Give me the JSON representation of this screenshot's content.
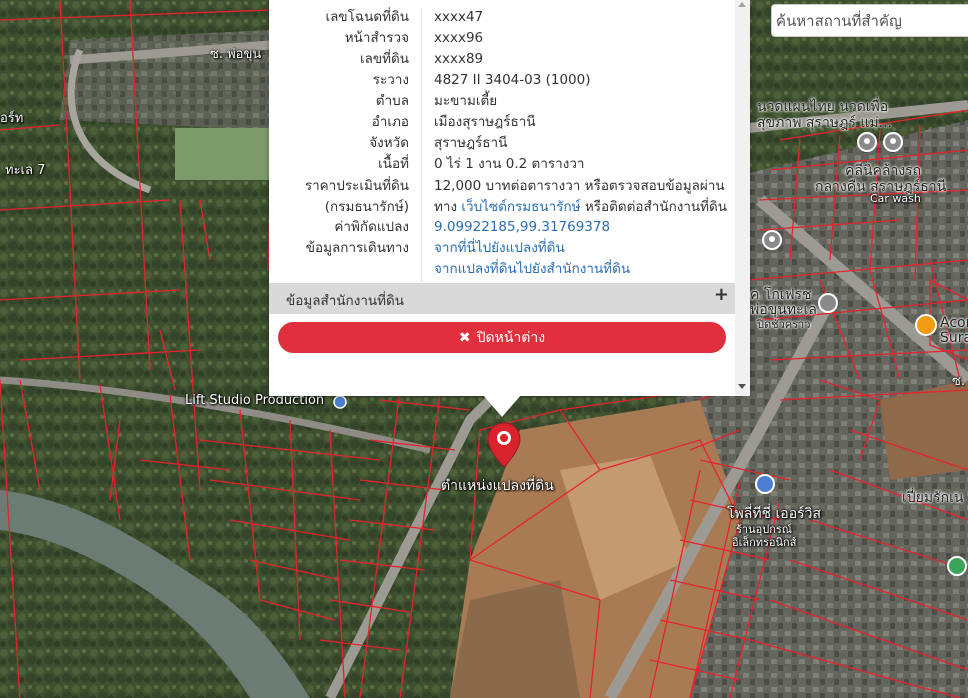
{
  "search": {
    "placeholder": "ค้นหาสถานที่สำคัญ"
  },
  "popup": {
    "rows": [
      {
        "key": "เลขโฉนดที่ดิน",
        "value": "xxxx47"
      },
      {
        "key": "หน้าสำรวจ",
        "value": "xxxx96"
      },
      {
        "key": "เลขที่ดิน",
        "value": "xxxx89"
      },
      {
        "key": "ระวาง",
        "value": "4827 II 3404-03 (1000)"
      },
      {
        "key": "ตำบล",
        "value": "มะขามเตี้ย"
      },
      {
        "key": "อำเภอ",
        "value": "เมืองสุราษฎร์ธานี"
      },
      {
        "key": "จังหวัด",
        "value": "สุราษฎร์ธานี"
      },
      {
        "key": "เนื้อที่",
        "value": "0 ไร่ 1 งาน 0.2 ตารางวา"
      }
    ],
    "price": {
      "key1": "ราคาประเมินที่ดิน",
      "key2": "(กรมธนารักษ์)",
      "line1": "12,000 บาทต่อตารางวา หรือตรวจสอบข้อมูลผ่าน",
      "line2_pre": "ทาง ",
      "line2_link": "เว็บไซต์กรมธนารักษ์",
      "line2_post": " หรือติดต่อสำนักงานที่ดิน"
    },
    "coords": {
      "key": "ค่าพิกัดแปลง",
      "value": "9.09922185,99.31769378"
    },
    "travel": {
      "key": "ข้อมูลการเดินทาง",
      "link1": "จากที่นี่ไปยังแปลงที่ดิน",
      "link2": "จากแปลงที่ดินไปยังสำนักงานที่ดิน"
    },
    "accordion_label": "ข้อมูลสำนักงานที่ดิน",
    "accordion_icon": "+",
    "close_icon": "✖",
    "close_label": "ปิดหน้าต่าง"
  },
  "marker_label": "ตำแหน่งแปลงที่ดิน",
  "map_labels": {
    "lift_studio": "Lift Studio Production",
    "road_top": "ซ. พ่อขุน",
    "road_left": "ทะเล 7",
    "left_top": "อร์ท",
    "massage": "นวดแผนไทย นวดเพื่อ",
    "massage2": "สุขภาพ สุราษฎร์ แม่...",
    "carwash1": "คลีนิคล้างรถ",
    "carwash2": "กลางคืน สุราษฎร์ธานี",
    "carwash3": "Car wash",
    "shop1": "ค โกเฟรช",
    "shop2": "พ่อขุนทะเล",
    "shop3": "ปิดชั่วคราว",
    "acorn1": "Acor",
    "acorn2": "Sura",
    "power1": "โพลี่ทีชี่ เออร์วิส",
    "power2": "ร้านอุปกรณ์",
    "power3": "อิเล็กทรอนิกส์",
    "right_mid": "เปี่ยมรักเน",
    "right_road": "ซ. "
  },
  "colors": {
    "parcel_line": "#e8222c",
    "button_red": "#e0303e",
    "link_blue": "#2a6fb5",
    "accordion_bg": "#d9d9d9"
  }
}
